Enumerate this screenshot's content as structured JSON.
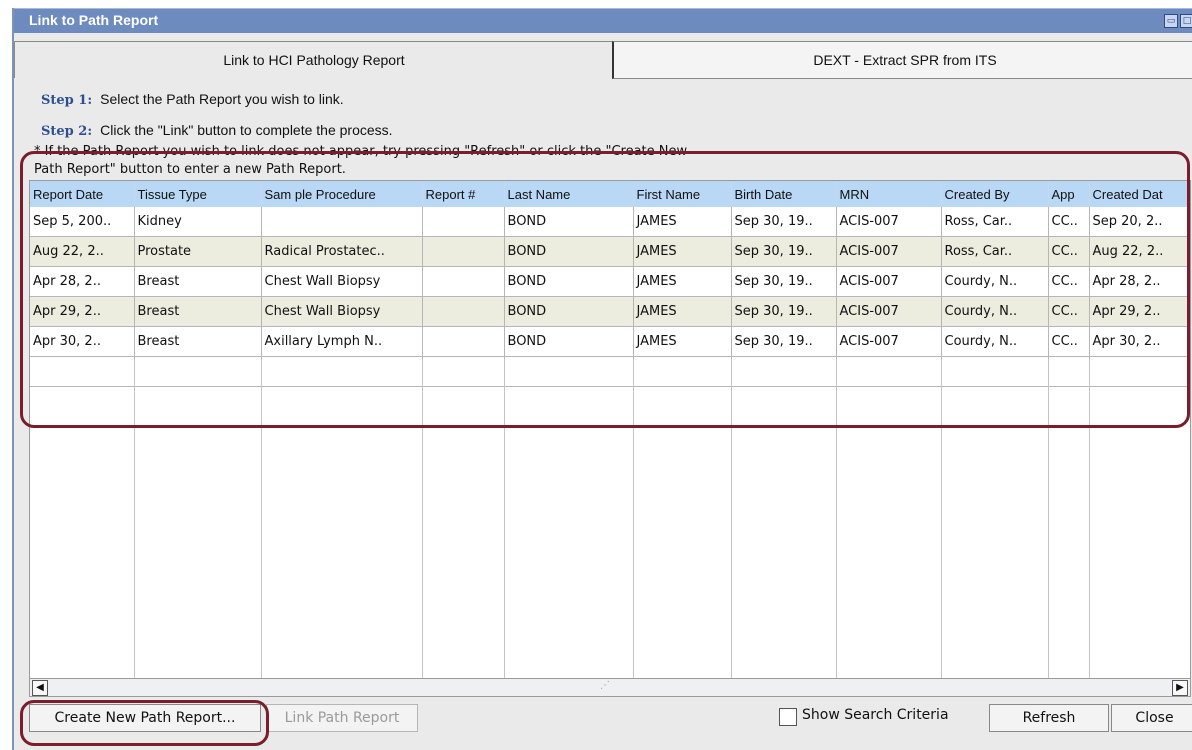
{
  "window": {
    "title": "Link to Path Report"
  },
  "tabs": [
    {
      "label": "Link to HCI Pathology Report"
    },
    {
      "label": "DEXT - Extract SPR from ITS"
    }
  ],
  "steps": [
    {
      "num": "Step 1:",
      "text": "Select the Path Report you wish to link."
    },
    {
      "num": "Step 2:",
      "text": "Click the \"Link\" button to complete the process."
    }
  ],
  "note": {
    "line1": "* If the Path Report you wish to link does not appear, try pressing \"Refresh\" or click the \"Create New",
    "line2": "Path Report\" button to enter a new Path Report."
  },
  "table": {
    "columns": [
      "Report Date",
      "Tissue Type",
      "Sam ple Procedure",
      "Report #",
      "Last Name",
      "First Name",
      "Birth Date",
      "MRN",
      "Created By",
      "App",
      "Created Dat"
    ],
    "rows": [
      [
        "Sep 5, 200..",
        "Kidney",
        "",
        "",
        "BOND",
        "JAMES",
        "Sep 30, 19..",
        "ACIS-007",
        "Ross, Car..",
        "CC..",
        "Sep 20, 2.."
      ],
      [
        "Aug 22, 2..",
        "Prostate",
        "Radical Prostatec..",
        "",
        "BOND",
        "JAMES",
        "Sep 30, 19..",
        "ACIS-007",
        "Ross, Car..",
        "CC..",
        "Aug 22, 2.."
      ],
      [
        "Apr 28, 2..",
        "Breast",
        "Chest Wall Biopsy",
        "",
        "BOND",
        "JAMES",
        "Sep 30, 19..",
        "ACIS-007",
        "Courdy, N..",
        "CC..",
        "Apr 28, 2.."
      ],
      [
        "Apr 29, 2..",
        "Breast",
        "Chest Wall Biopsy",
        "",
        "BOND",
        "JAMES",
        "Sep 30, 19..",
        "ACIS-007",
        "Courdy, N..",
        "CC..",
        "Apr 29, 2.."
      ],
      [
        "Apr 30, 2..",
        "Breast",
        "Axillary Lymph N..",
        "",
        "BOND",
        "JAMES",
        "Sep 30, 19..",
        "ACIS-007",
        "Courdy, N..",
        "CC..",
        "Apr 30, 2.."
      ]
    ]
  },
  "buttons": {
    "create": "Create New Path Report...",
    "link": "Link Path Report",
    "show_criteria": "Show Search Criteria",
    "refresh": "Refresh",
    "close": "Close"
  },
  "colors": {
    "titlebar": "#6e8bbf",
    "header": "#b9d8f5",
    "highlight": "#7a1d2c"
  }
}
